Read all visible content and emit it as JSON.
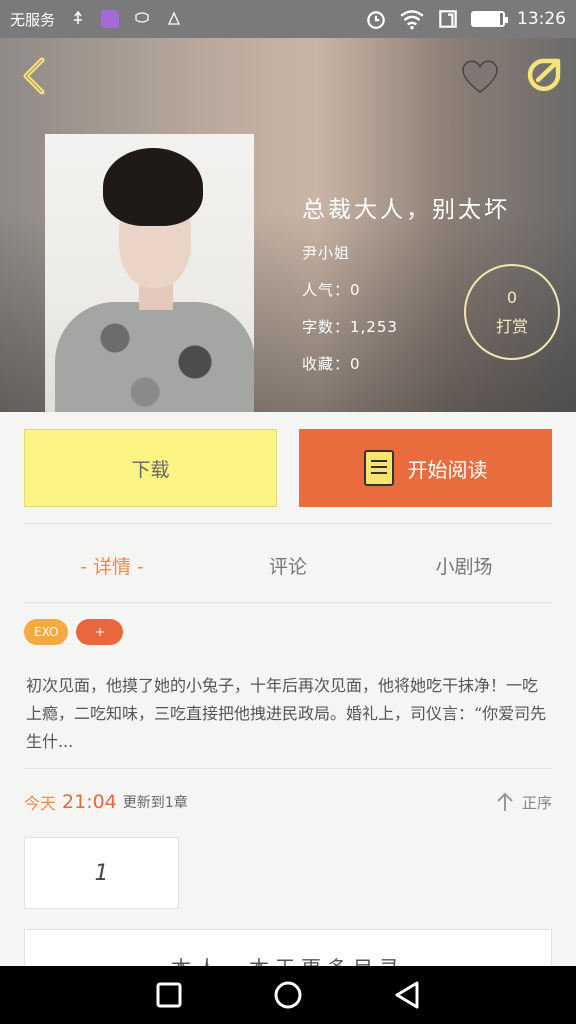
{
  "status_bar": {
    "carrier": "无服务",
    "time": "13:26",
    "battery_level": 0.9,
    "icons": [
      "usb-icon",
      "gallery-icon",
      "chat-icon",
      "notification-icon",
      "alarm-icon",
      "wifi-icon",
      "sim-icon",
      "battery-icon"
    ]
  },
  "header": {
    "icons": [
      "back-icon",
      "heart-icon",
      "share-icon"
    ],
    "accent_color": "#f5e47a"
  },
  "book": {
    "title": "总裁大人，别太坏",
    "author": "尹小姐",
    "popularity": "人气：0",
    "word_count": "字数：1,253",
    "favorites": "收藏：0",
    "tip_count": "0",
    "tip_label": "打赏"
  },
  "actions": {
    "download_label": "下载",
    "read_label": "开始阅读"
  },
  "tabs": [
    {
      "label": "- 详情 -",
      "active": true
    },
    {
      "label": "评论",
      "active": false
    },
    {
      "label": "小剧场",
      "active": false
    }
  ],
  "tags": [
    "EXO",
    "+"
  ],
  "description": "初次见面，他摸了她的小兔子，十年后再次见面，他将她吃干抹净！一吃上瘾，二吃知味，三吃直接把他拽进民政局。婚礼上，司仪言：“你爱司先生什...",
  "update": {
    "today": "今天",
    "time": "21:04",
    "tail": "更新到1章",
    "sort_label": "正序"
  },
  "chapters": [
    "1"
  ],
  "more_text": "本人，本王更多目录",
  "colors": {
    "orange": "#e86c3d",
    "yellow": "#fbf383",
    "tab_active": "#f08a4b"
  }
}
